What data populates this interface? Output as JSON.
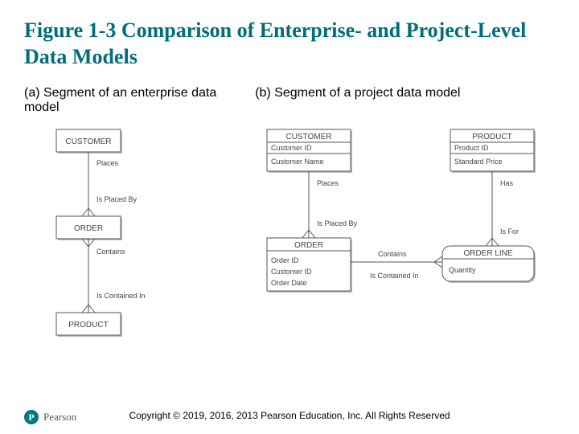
{
  "title": "Figure 1-3 Comparison of Enterprise- and Project-Level Data Models",
  "caption_a": "(a) Segment of an enterprise data model",
  "caption_b": "(b) Segment of a project data model",
  "diagram_a": {
    "entities": [
      {
        "name": "CUSTOMER"
      },
      {
        "name": "ORDER"
      },
      {
        "name": "PRODUCT"
      }
    ],
    "relationships": {
      "places": "Places",
      "is_placed_by": "Is Placed By",
      "contains": "Contains",
      "is_contained_in": "Is Contained In"
    }
  },
  "diagram_b": {
    "entities": {
      "customer": {
        "name": "CUSTOMER",
        "attrs": [
          "Customer ID",
          "Customer Name"
        ]
      },
      "product": {
        "name": "PRODUCT",
        "attrs": [
          "Product ID",
          "Standard Price"
        ]
      },
      "order": {
        "name": "ORDER",
        "attrs": [
          "Order ID",
          "Customer ID",
          "Order Date"
        ]
      },
      "order_line": {
        "name": "ORDER LINE",
        "attrs": [
          "Quantity"
        ]
      }
    },
    "relationships": {
      "places": "Places",
      "is_placed_by": "Is Placed By",
      "has": "Has",
      "is_for": "Is For",
      "contains": "Contains",
      "is_contained_in": "Is Contained In"
    }
  },
  "brand": {
    "logo_letter": "P",
    "name": "Pearson"
  },
  "copyright": "Copyright © 2019, 2016, 2013 Pearson Education, Inc. All Rights Reserved"
}
